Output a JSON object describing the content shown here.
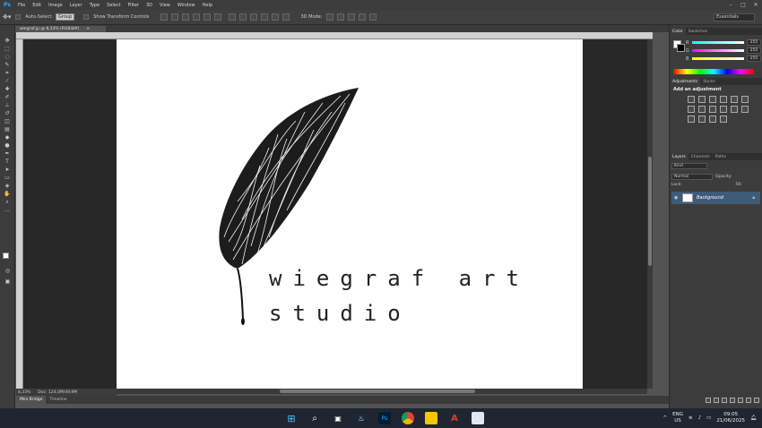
{
  "app": {
    "logo": "Ps",
    "menu": [
      "File",
      "Edit",
      "Image",
      "Layer",
      "Type",
      "Select",
      "Filter",
      "3D",
      "View",
      "Window",
      "Help"
    ]
  },
  "options_bar": {
    "auto_select_label": "Auto-Select:",
    "auto_select_value": "Group",
    "show_transform_label": "Show Transform Controls",
    "mode_3d_label": "3D Mode:",
    "workspace": "Essentials"
  },
  "document": {
    "tab_title": "wiegraf.jp @ 8,33% (RGB/8#)",
    "zoom": "8,33%",
    "doc_size": "Doc: 124,0M/49,9M"
  },
  "artwork": {
    "line1": "wiegraf art",
    "line2": "studio"
  },
  "bottom_tabs": [
    "Mini Bridge",
    "Timeline"
  ],
  "panels": {
    "color_tabs": [
      "Color",
      "Swatches"
    ],
    "color": {
      "r_label": "R",
      "r_value": "255",
      "g_label": "G",
      "g_value": "255",
      "b_label": "B",
      "b_value": "255"
    },
    "adjust_tabs": [
      "Adjustments",
      "Styles"
    ],
    "adjust_title": "Add an adjustment",
    "layers_tabs": [
      "Layers",
      "Channels",
      "Paths"
    ],
    "layer_kind": "Kind",
    "blend_mode": "Normal",
    "opacity_label": "Opacity:",
    "lock_label": "Lock:",
    "fill_label": "Fill:",
    "layer_name": "Background"
  },
  "taskbar": {
    "lang_top": "ENG",
    "lang_bottom": "US",
    "time": "09:05",
    "date": "21/06/2025"
  },
  "colors": {
    "app_bg": "#535353",
    "canvas": "#ffffff",
    "ps_blue": "#31a8ff",
    "layer_selected": "#3e5b7a"
  }
}
